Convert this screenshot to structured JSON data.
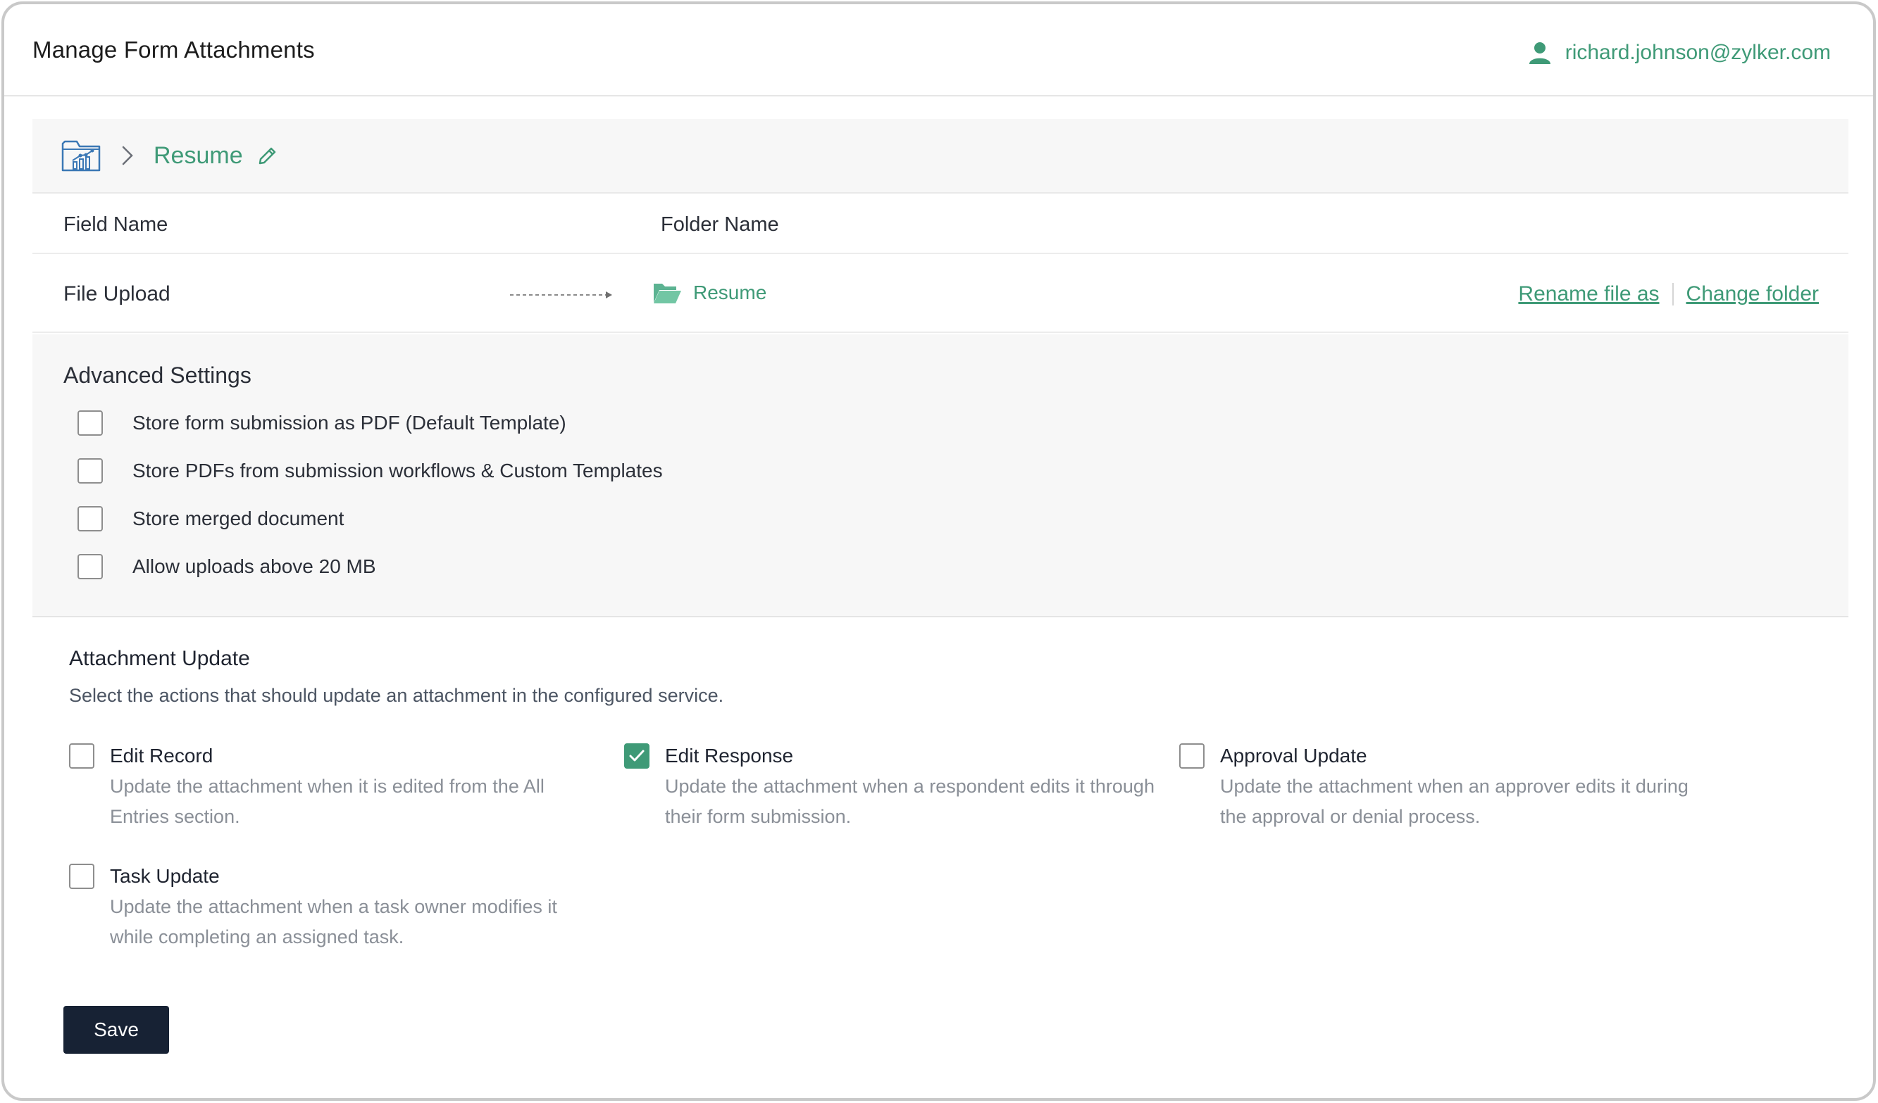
{
  "header": {
    "title": "Manage Form Attachments",
    "user_email": "richard.johnson@zylker.com"
  },
  "breadcrumb": {
    "folder_name": "Resume"
  },
  "mapping": {
    "columns": {
      "field": "Field Name",
      "folder": "Folder Name"
    },
    "row": {
      "field": "File Upload",
      "folder": "Resume",
      "rename_link": "Rename file as",
      "change_link": "Change folder"
    }
  },
  "advanced": {
    "title": "Advanced Settings",
    "options": [
      {
        "label": "Store form submission as PDF (Default Template)",
        "checked": false
      },
      {
        "label": "Store PDFs from submission workflows & Custom Templates",
        "checked": false
      },
      {
        "label": "Store merged document",
        "checked": false
      },
      {
        "label": "Allow uploads above 20 MB",
        "checked": false
      }
    ]
  },
  "attachment_update": {
    "title": "Attachment Update",
    "description": "Select the actions that should update an attachment in the configured service.",
    "actions": [
      {
        "title": "Edit Record",
        "description": "Update the attachment when it is edited from the All Entries section.",
        "checked": false
      },
      {
        "title": "Edit Response",
        "description": "Update the attachment when a respondent edits it through their form submission.",
        "checked": true
      },
      {
        "title": "Approval Update",
        "description": "Update the attachment when an approver edits it during the approval or denial process.",
        "checked": false
      },
      {
        "title": "Task Update",
        "description": "Update the attachment when a task owner modifies it while completing an assigned task.",
        "checked": false
      }
    ]
  },
  "save_label": "Save",
  "colors": {
    "accent": "#3f9a77",
    "save_button": "#172234",
    "panel_bg": "#f7f7f7"
  },
  "icons": [
    "user-icon",
    "folder-chart-icon",
    "chevron-right-icon",
    "pencil-icon",
    "arrow-icon",
    "open-folder-icon",
    "check-icon"
  ]
}
